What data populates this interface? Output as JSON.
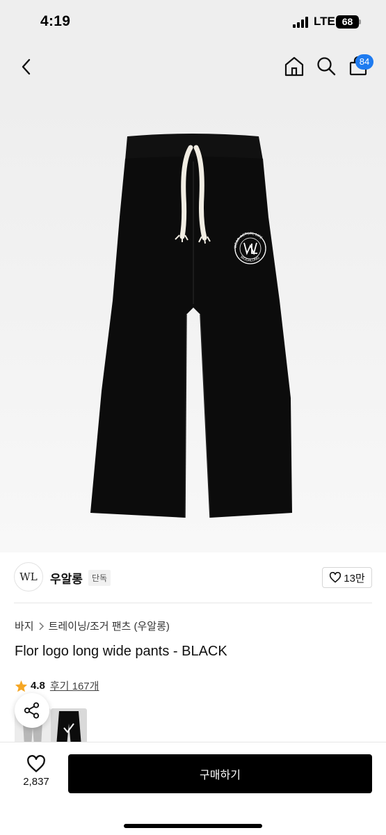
{
  "status_bar": {
    "time": "4:19",
    "network": "LTE",
    "battery": "68"
  },
  "nav": {
    "cart_count": "84"
  },
  "brand": {
    "logo_text": "WL",
    "name": "우알롱",
    "tag": "단독",
    "likes": "13만"
  },
  "breadcrumb": [
    "바지",
    "트레이닝/조거 팬츠 (우알롱)"
  ],
  "product": {
    "title": "Flor logo long wide pants - BLACK",
    "rating": "4.8",
    "reviews_label": "후기 167개",
    "logo_print": {
      "top_text": "WEAR ACTUAL LIFE",
      "bottom_text": "WOOALONG",
      "monogram": "WL"
    }
  },
  "bottom_bar": {
    "wish_count": "2,837",
    "buy_label": "구매하기"
  },
  "colors": {
    "accent_badge": "#1e7bf0",
    "buy_button": "#000000",
    "star": "#f5a623"
  },
  "icons": [
    "back-icon",
    "home-icon",
    "search-icon",
    "cart-icon",
    "heart-icon",
    "share-icon",
    "star-icon",
    "chevron-right-icon"
  ]
}
